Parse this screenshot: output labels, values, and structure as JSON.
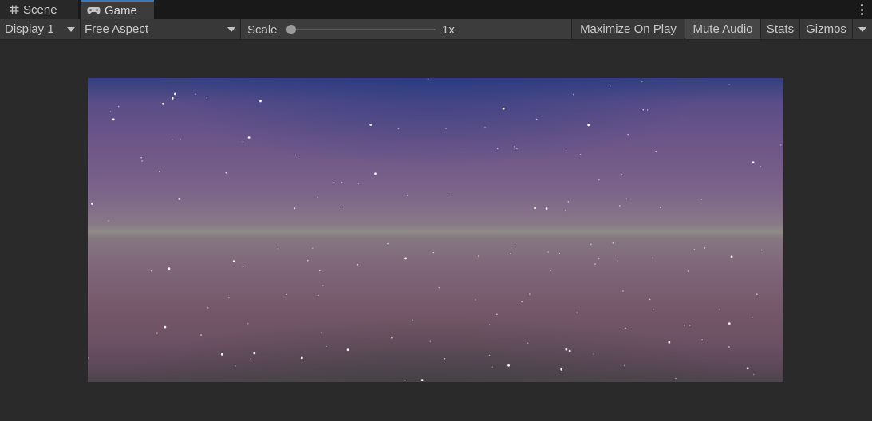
{
  "tabs": [
    {
      "label": "Scene",
      "icon": "grid-icon",
      "active": false
    },
    {
      "label": "Game",
      "icon": "gamepad-icon",
      "active": true
    }
  ],
  "toolbar": {
    "display": "Display 1",
    "aspect": "Free Aspect",
    "scale_label": "Scale",
    "scale_value": "1x",
    "scale_fraction": 0.0,
    "maximize_on_play": "Maximize On Play",
    "mute_audio": "Mute Audio",
    "stats": "Stats",
    "gizmos": "Gizmos"
  },
  "toggles": {
    "maximize_on_play": false,
    "mute_audio": true,
    "stats": false,
    "gizmos": false
  },
  "colors": {
    "accent": "#3a79bb",
    "panel": "#3c3c3c",
    "background": "#282828",
    "tabbar": "#191919"
  }
}
